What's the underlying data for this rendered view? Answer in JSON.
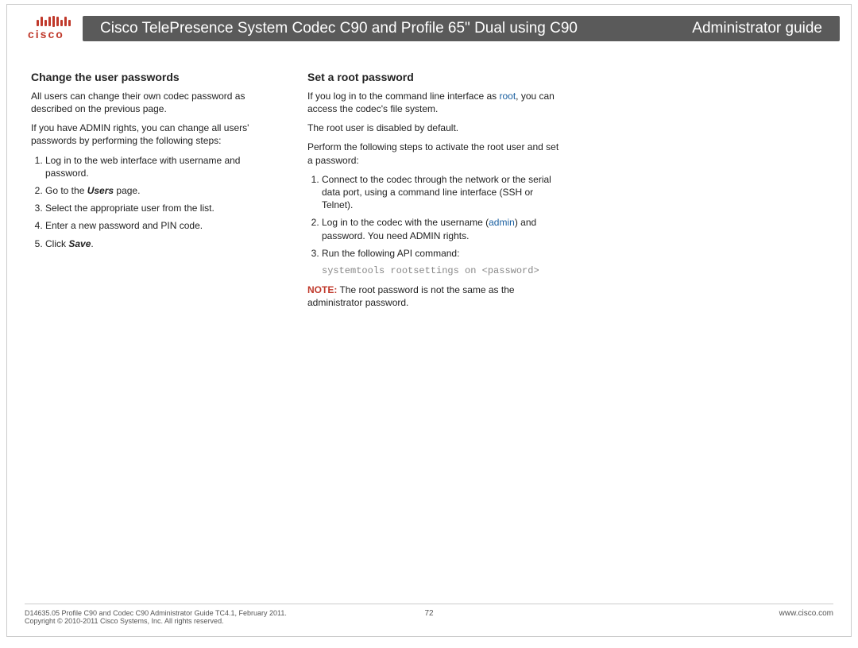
{
  "brand": "cisco",
  "header": {
    "title": "Cisco TelePresence System Codec C90 and Profile 65\" Dual using C90",
    "right": "Administrator guide"
  },
  "left": {
    "heading": "Change the user passwords",
    "p1": "All users can change their own codec password as described on the previous page.",
    "p2": "If you have ADMIN rights, you can change all users' passwords by performing the following steps:",
    "steps": {
      "s1": "Log in to the web interface with username and password.",
      "s2a": "Go to the ",
      "s2b": "Users",
      "s2c": " page.",
      "s3": "Select the appropriate user from the list.",
      "s4": "Enter a new password and PIN code.",
      "s5a": "Click ",
      "s5b": "Save",
      "s5c": "."
    }
  },
  "right": {
    "heading": "Set a root password",
    "p1a": "If you log in to the command line interface as ",
    "p1link": "root",
    "p1b": ", you can access the codec's file system.",
    "p2": "The root user is disabled by default.",
    "p3": "Perform the following steps to activate the root user and set a password:",
    "steps": {
      "s1": "Connect to the codec through the network or the serial data port, using a command line interface (SSH or Telnet).",
      "s2a": "Log in to the codec with the username (",
      "s2link": "admin",
      "s2b": ") and password. You need ADMIN rights.",
      "s3": "Run the following API command:"
    },
    "cmd": "systemtools rootsettings on <password>",
    "note_label": "NOTE:",
    "note_text": " The root password is not the same as the administrator password."
  },
  "footer": {
    "line1": "D14635.05 Profile C90 and Codec C90 Administrator Guide TC4.1, February 2011.",
    "line2": "Copyright © 2010-2011 Cisco Systems, Inc. All rights reserved.",
    "page": "72",
    "url": "www.cisco.com"
  }
}
